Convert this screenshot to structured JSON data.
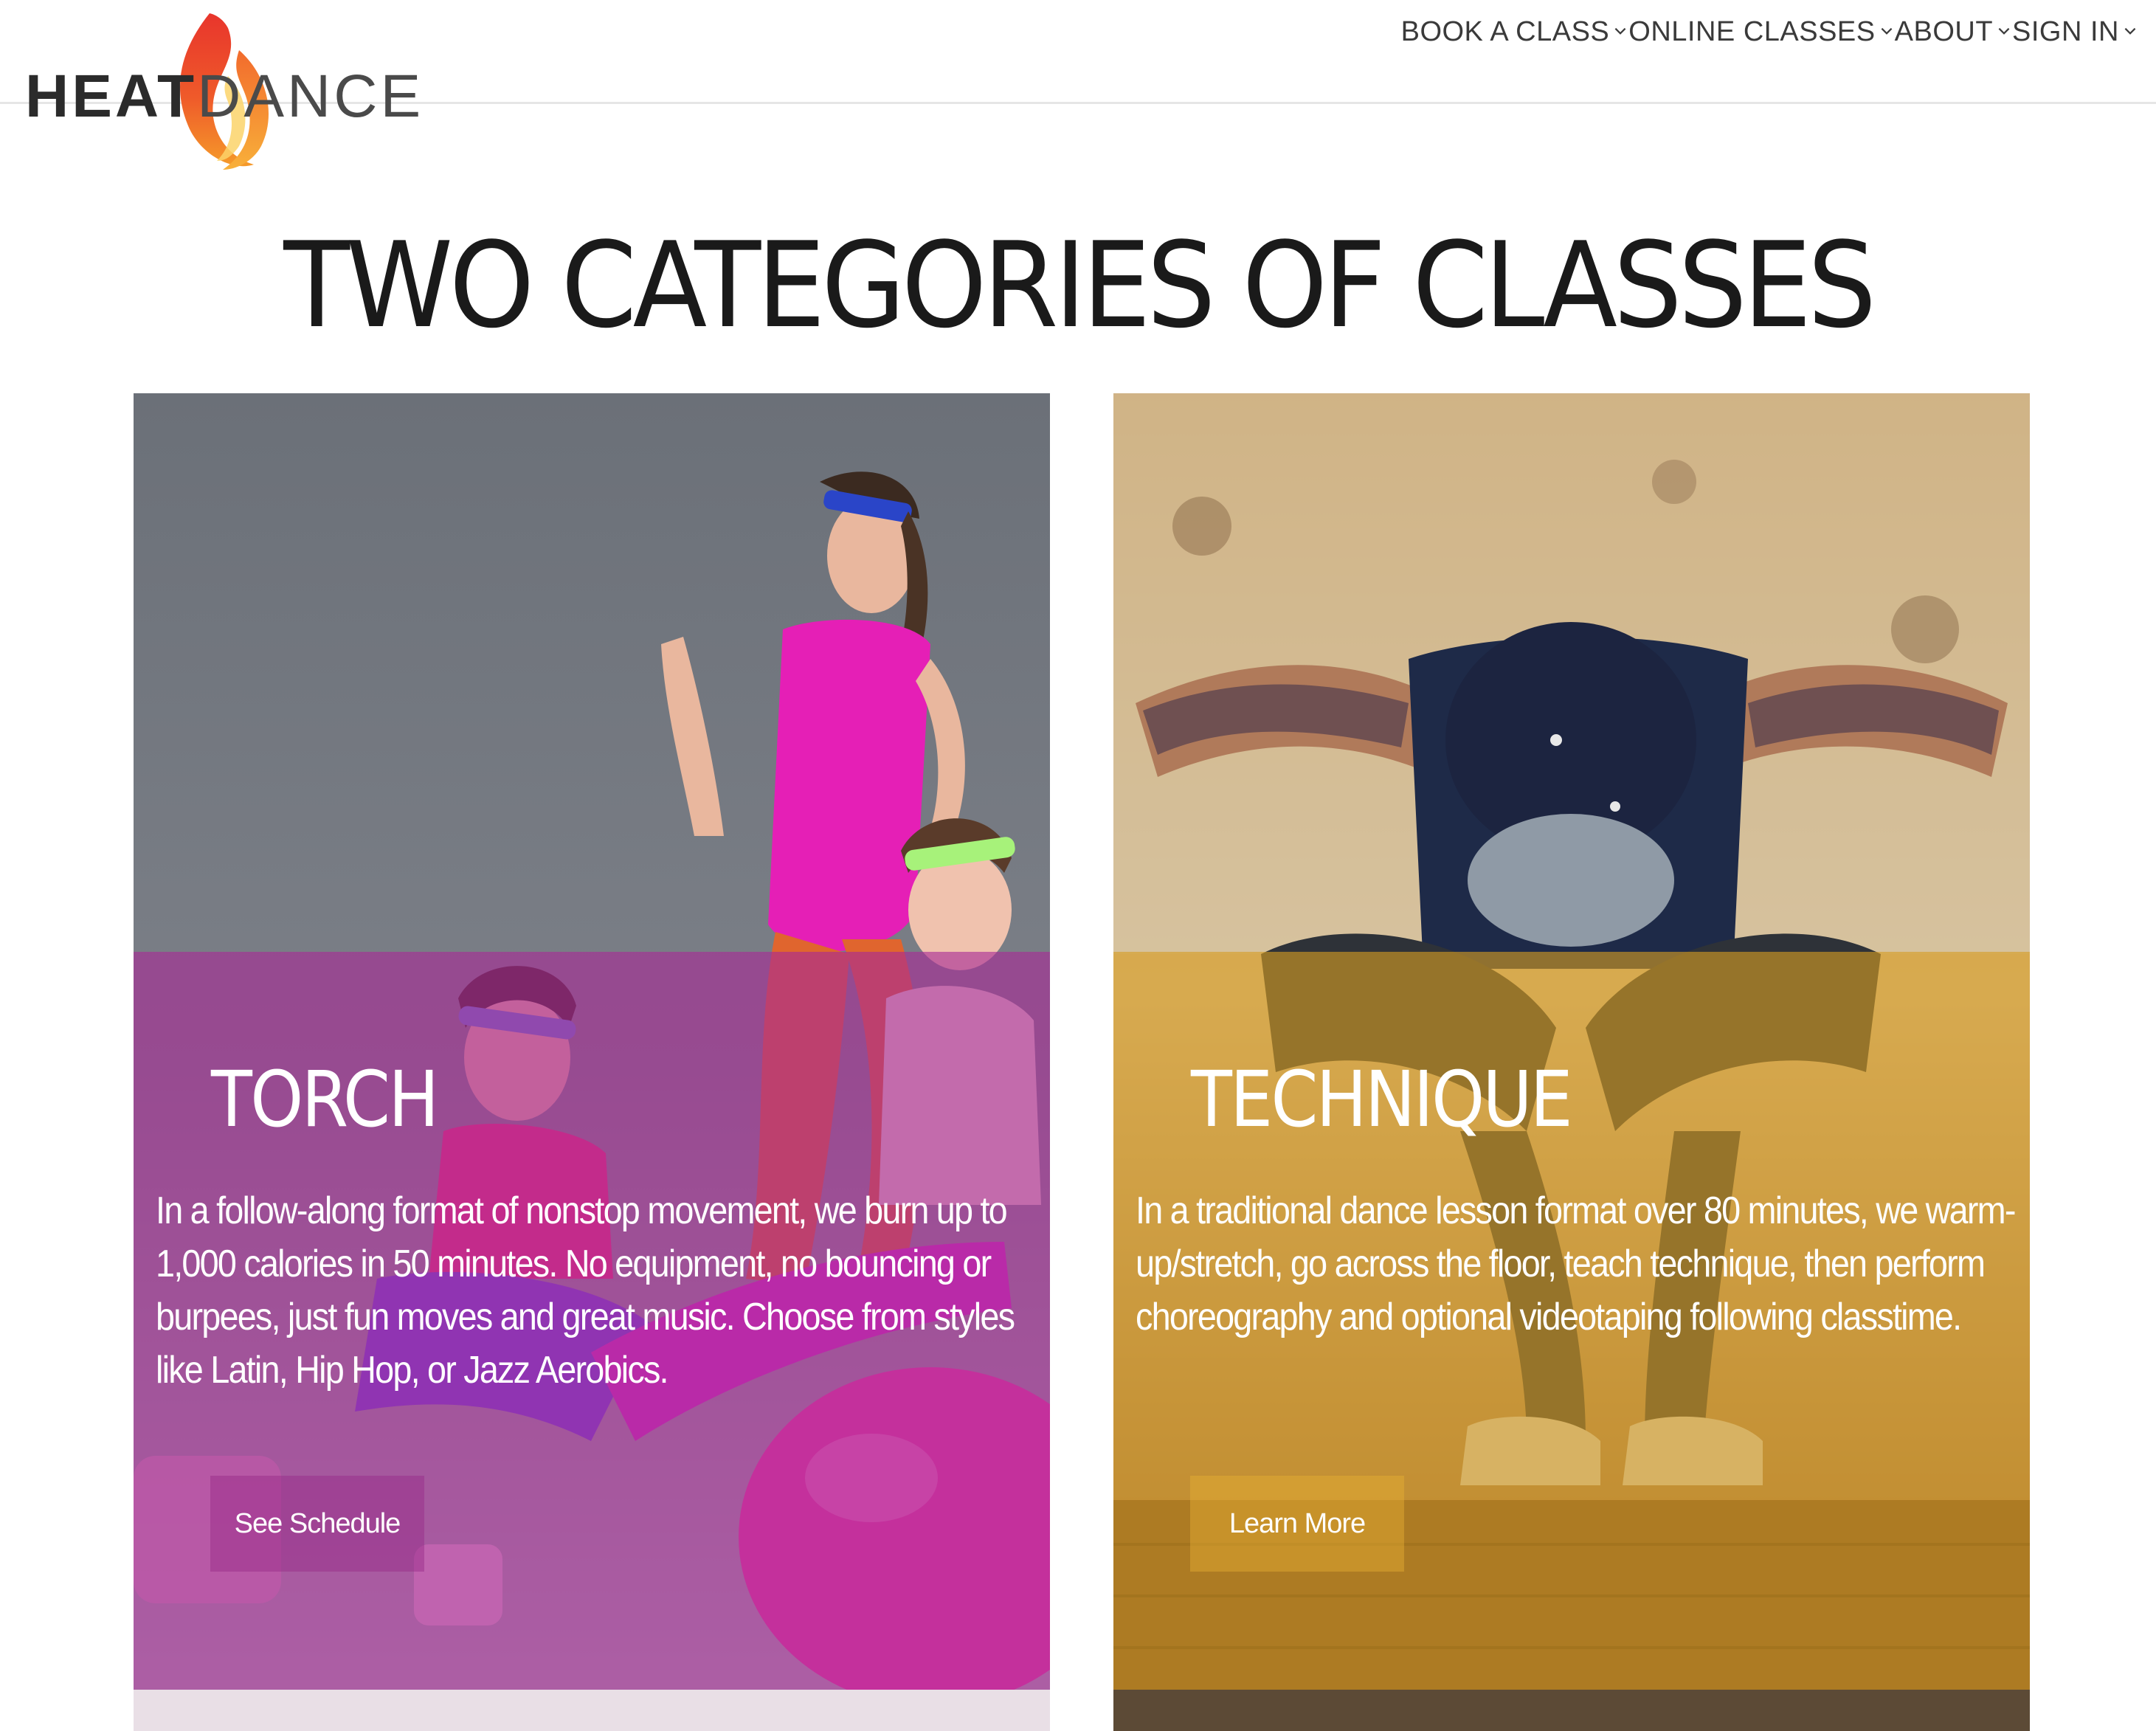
{
  "brand": {
    "name_part_1": "HEAT",
    "name_part_2": "DANCE",
    "flame_icon": "flame-icon",
    "colors": {
      "flame_red": "#e8352c",
      "flame_orange": "#f59a2a",
      "text_dark": "#2b2b2b"
    }
  },
  "nav": {
    "items": [
      {
        "label": "BOOK A CLASS",
        "icon": "chevron-down-icon"
      },
      {
        "label": "ONLINE CLASSES",
        "icon": "chevron-down-icon"
      },
      {
        "label": "ABOUT",
        "icon": "chevron-down-icon"
      },
      {
        "label": "SIGN IN",
        "icon": "chevron-down-icon"
      }
    ]
  },
  "page": {
    "title": "TWO CATEGORIES OF CLASSES"
  },
  "cards": [
    {
      "heading": "TORCH",
      "body": "In a follow-along format of nonstop movement, we burn up to 1,000 calories in 50 minutes. No equipment, no bouncing or burpees, just fun moves and great music. Choose from styles like Latin, Hip Hop, or Jazz Aerobics.",
      "button_label": "See Schedule",
      "overlay_color": "#a82a96",
      "image": "aerobics-dancers-photo"
    },
    {
      "heading": "TECHNIQUE",
      "body": "In a traditional dance lesson format over 80 minutes, we warm-up/stretch, go across the floor, teach technique, then perform choreography and optional videotaping following classtime.",
      "button_label": "Learn More",
      "overlay_color": "#d69c22",
      "image": "hip-hop-dancer-photo"
    }
  ]
}
